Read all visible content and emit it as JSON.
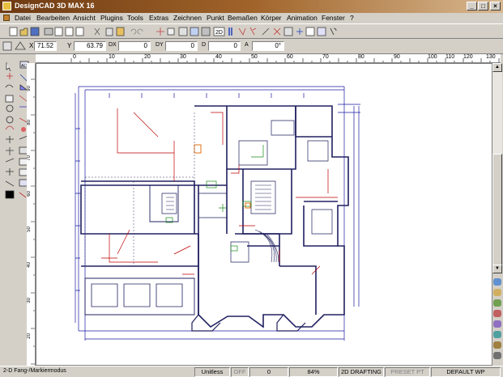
{
  "title": "DesignCAD 3D MAX 16",
  "menu": [
    "Datei",
    "Bearbeiten",
    "Ansicht",
    "Plugins",
    "Tools",
    "Extras",
    "Zeichnen",
    "Punkt",
    "Bemaßen",
    "Körper",
    "Animation",
    "Fenster",
    "?"
  ],
  "coords": {
    "x_value": "71.52",
    "y_value": "63.79",
    "dx_label": "DX",
    "dx_value": "0",
    "dy_label": "DY",
    "dy_value": "0",
    "d_label": "D",
    "d_value": "0",
    "a_label": "A",
    "a_value": "0°"
  },
  "ruler_top": [
    "0",
    "10",
    "20",
    "30",
    "40",
    "50",
    "60",
    "70",
    "80",
    "90",
    "100",
    "110",
    "120",
    "130"
  ],
  "ruler_left": [
    "90",
    "80",
    "70",
    "60",
    "50",
    "40",
    "30",
    "20",
    "10",
    "0"
  ],
  "status": {
    "mode_text": "2-D Fang-/Markiermodus",
    "units": "Unitless",
    "off": "OFF",
    "zero": "0",
    "zoom": "84%",
    "drafting": "2D DRAFTING",
    "preset": "PRESET PT",
    "default_wp": "DEFAULT WP"
  },
  "colors": {
    "title_start": "#6e3a12",
    "title_end": "#d8b890",
    "plan_lines": "#202060",
    "dim_lines": "#1a1aa0",
    "red_lines": "#c00000",
    "green_lines": "#1a8a1a"
  }
}
